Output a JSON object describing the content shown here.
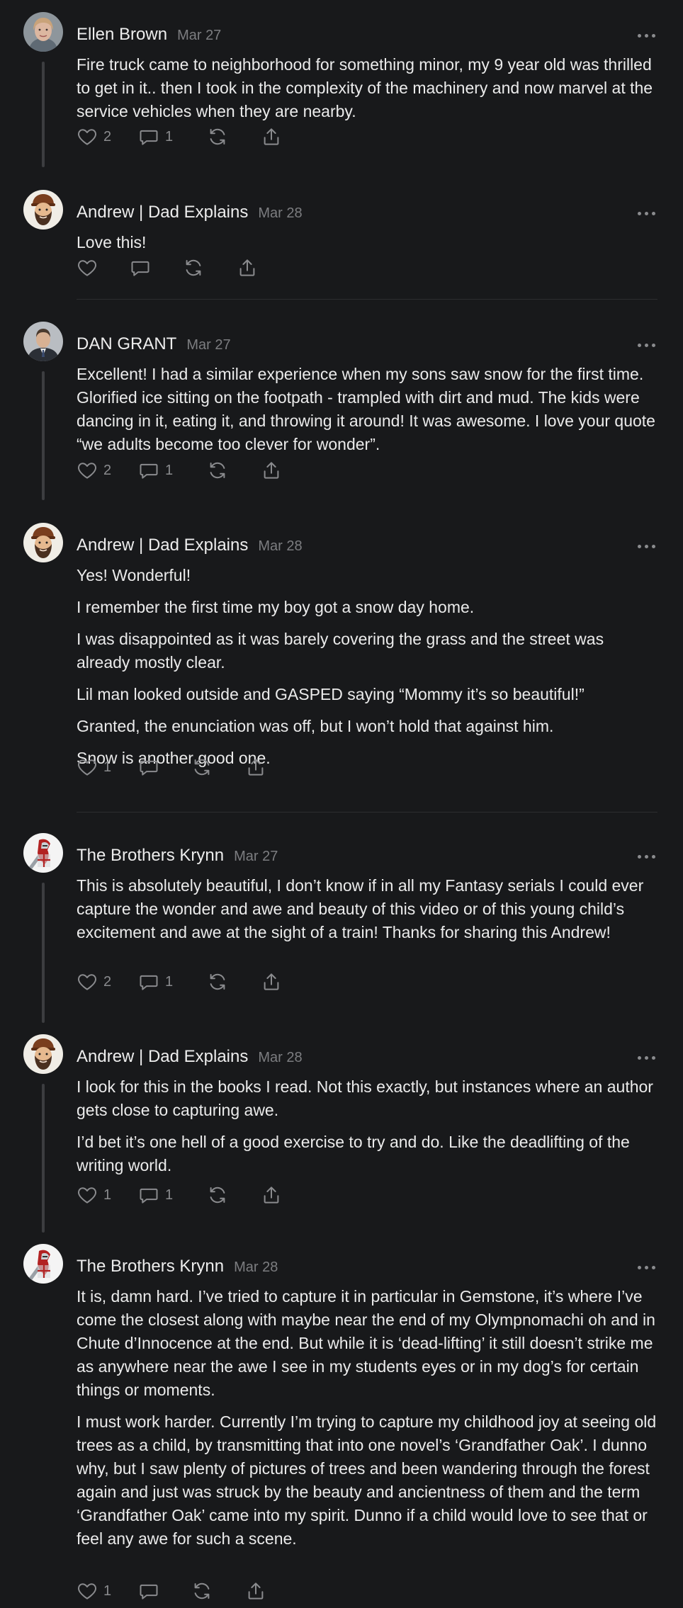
{
  "comments": [
    {
      "author": "Ellen Brown",
      "date": "Mar 27",
      "avatar": "woman-photo",
      "paragraphs": [
        "Fire truck came to neighborhood for something minor, my 9 year old was thrilled to get in it.. then I took in the complexity of the machinery and now marvel at the service vehicles when they are nearby."
      ],
      "likes": "2",
      "replies": "1"
    },
    {
      "author": "Andrew | Dad Explains",
      "date": "Mar 28",
      "avatar": "bearded-man-illustration",
      "paragraphs": [
        "Love this!"
      ],
      "likes": "",
      "replies": ""
    },
    {
      "author": "DAN GRANT",
      "date": "Mar 27",
      "avatar": "man-in-suit-photo",
      "paragraphs": [
        "Excellent! I had a similar experience when my sons saw snow for the first time. Glorified ice sitting on the footpath - trampled with dirt and mud. The kids were dancing in it, eating it, and throwing it around! It was awesome. I love your quote “we adults become too clever for wonder”."
      ],
      "likes": "2",
      "replies": "1"
    },
    {
      "author": "Andrew | Dad Explains",
      "date": "Mar 28",
      "avatar": "bearded-man-illustration",
      "paragraphs": [
        "Yes! Wonderful!",
        "I remember the first time my boy got a snow day home.",
        "I was disappointed as it was barely covering the grass and the street was already mostly clear.",
        "Lil man looked outside and GASPED saying “Mommy it’s so beautiful!”",
        "Granted, the enunciation was off, but I won’t hold that against him.",
        "Snow is another good one."
      ],
      "likes": "1",
      "replies": ""
    },
    {
      "author": "The Brothers Krynn",
      "date": "Mar 27",
      "avatar": "knight-logo",
      "paragraphs": [
        "This is absolutely beautiful, I don’t know if in all my Fantasy serials I could ever capture the wonder and awe and beauty of this video or of this young child’s excitement and awe at the sight of a train! Thanks for sharing this Andrew!"
      ],
      "likes": "2",
      "replies": "1"
    },
    {
      "author": "Andrew | Dad Explains",
      "date": "Mar 28",
      "avatar": "bearded-man-illustration",
      "paragraphs": [
        "I look for this in the books I read. Not this exactly, but instances where an author gets close to capturing awe.",
        "I’d bet it’s one hell of a good exercise to try and do. Like the deadlifting of the writing world."
      ],
      "likes": "1",
      "replies": "1"
    },
    {
      "author": "The Brothers Krynn",
      "date": "Mar 28",
      "avatar": "knight-logo",
      "paragraphs": [
        "It is, damn hard. I’ve tried to capture it in particular in Gemstone, it’s where I’ve come the closest along with maybe near the end of my Olympnomachi oh and in Chute d’Innocence at the end. But while it is ‘dead-lifting’ it still doesn’t strike me as anywhere near the awe I see in my students eyes or in my dog’s for certain things or moments.",
        "I must work harder. Currently I’m trying to capture my childhood joy at seeing old trees as a child, by transmitting that into one novel’s ‘Grandfather Oak’. I dunno why, but I saw plenty of pictures of trees and been wandering through the forest again and just was struck by the beauty and ancientness of them and the term ‘Grandfather Oak’ came into my spirit. Dunno if a child would love to see that or feel any awe for such a scene."
      ],
      "likes": "1",
      "replies": ""
    }
  ],
  "icons": {
    "like": "heart-icon",
    "reply": "speech-bubble-icon",
    "restack": "restack-arrows-icon",
    "share": "share-upload-icon",
    "more": "more-dots-icon"
  },
  "colors": {
    "background": "#18191b",
    "text": "#ebebeb",
    "muted": "#8a8b8e",
    "thread_line": "#3c3d40"
  }
}
